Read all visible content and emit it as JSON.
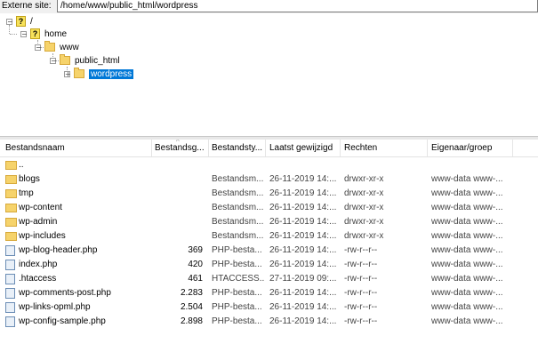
{
  "path_bar": {
    "label": "Externe site:",
    "value": "/home/www/public_html/wordpress"
  },
  "tree": {
    "root": "/",
    "home": "home",
    "www": "www",
    "public_html": "public_html",
    "wordpress": "wordpress"
  },
  "columns": {
    "name": "Bestandsnaam",
    "size": "Bestandsg...",
    "type": "Bestandsty...",
    "modified": "Laatst gewijzigd",
    "perms": "Rechten",
    "owner": "Eigenaar/groep"
  },
  "files": [
    {
      "name": "..",
      "size": "",
      "type": "",
      "modified": "",
      "perms": "",
      "owner": "",
      "kind": "folder"
    },
    {
      "name": "blogs",
      "size": "",
      "type": "Bestandsm...",
      "modified": "26-11-2019 14:...",
      "perms": "drwxr-xr-x",
      "owner": "www-data www-...",
      "kind": "folder"
    },
    {
      "name": "tmp",
      "size": "",
      "type": "Bestandsm...",
      "modified": "26-11-2019 14:...",
      "perms": "drwxr-xr-x",
      "owner": "www-data www-...",
      "kind": "folder"
    },
    {
      "name": "wp-content",
      "size": "",
      "type": "Bestandsm...",
      "modified": "26-11-2019 14:...",
      "perms": "drwxr-xr-x",
      "owner": "www-data www-...",
      "kind": "folder"
    },
    {
      "name": "wp-admin",
      "size": "",
      "type": "Bestandsm...",
      "modified": "26-11-2019 14:...",
      "perms": "drwxr-xr-x",
      "owner": "www-data www-...",
      "kind": "folder"
    },
    {
      "name": "wp-includes",
      "size": "",
      "type": "Bestandsm...",
      "modified": "26-11-2019 14:...",
      "perms": "drwxr-xr-x",
      "owner": "www-data www-...",
      "kind": "folder"
    },
    {
      "name": "wp-blog-header.php",
      "size": "369",
      "type": "PHP-besta...",
      "modified": "26-11-2019 14:...",
      "perms": "-rw-r--r--",
      "owner": "www-data www-...",
      "kind": "file"
    },
    {
      "name": "index.php",
      "size": "420",
      "type": "PHP-besta...",
      "modified": "26-11-2019 14:...",
      "perms": "-rw-r--r--",
      "owner": "www-data www-...",
      "kind": "file"
    },
    {
      "name": ".htaccess",
      "size": "461",
      "type": "HTACCESS...",
      "modified": "27-11-2019 09:...",
      "perms": "-rw-r--r--",
      "owner": "www-data www-...",
      "kind": "file"
    },
    {
      "name": "wp-comments-post.php",
      "size": "2.283",
      "type": "PHP-besta...",
      "modified": "26-11-2019 14:...",
      "perms": "-rw-r--r--",
      "owner": "www-data www-...",
      "kind": "file"
    },
    {
      "name": "wp-links-opml.php",
      "size": "2.504",
      "type": "PHP-besta...",
      "modified": "26-11-2019 14:...",
      "perms": "-rw-r--r--",
      "owner": "www-data www-...",
      "kind": "file"
    },
    {
      "name": "wp-config-sample.php",
      "size": "2.898",
      "type": "PHP-besta...",
      "modified": "26-11-2019 14:...",
      "perms": "-rw-r--r--",
      "owner": "www-data www-...",
      "kind": "file"
    }
  ]
}
